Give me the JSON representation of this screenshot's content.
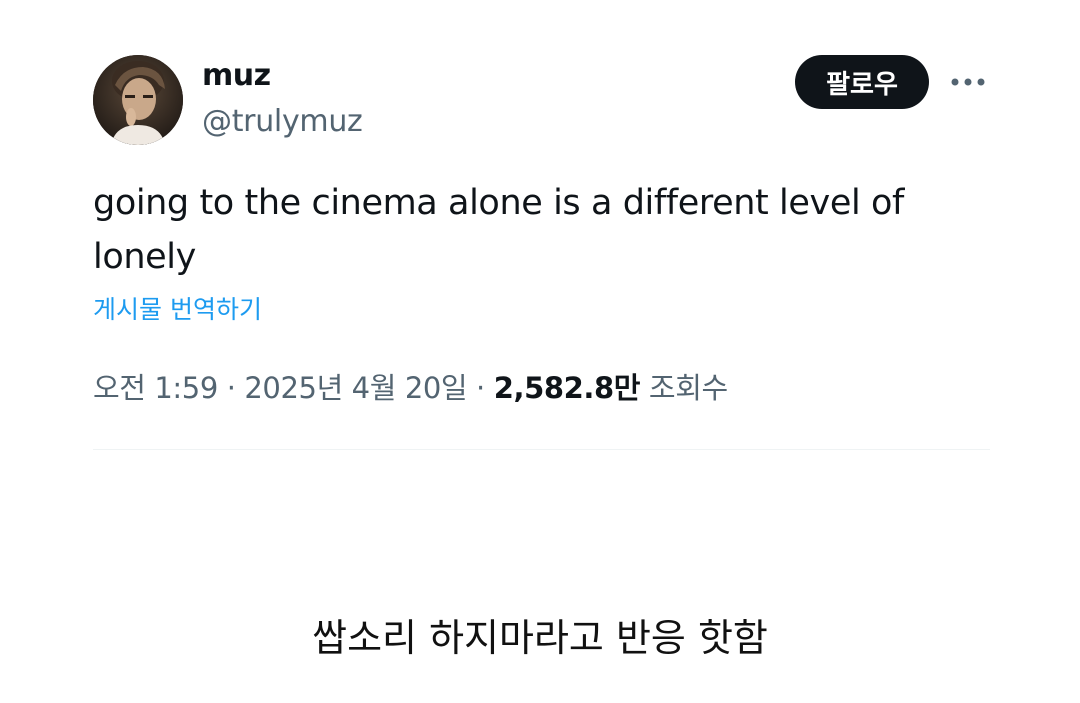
{
  "author": {
    "display_name": "muz",
    "handle": "@trulymuz"
  },
  "follow_button_label": "팔로우",
  "more_icon": "more-horizontal-icon",
  "tweet": {
    "text": "going to the cinema alone is a different level of lonely",
    "translate_label": "게시물 번역하기"
  },
  "meta": {
    "time": "오전 1:59",
    "separator": " · ",
    "date": "2025년 4월 20일",
    "views_count": "2,582.8만",
    "views_label": " 조회수"
  },
  "caption": "쌉소리 하지마라고 반응 핫함",
  "colors": {
    "link": "#1d9bf0",
    "secondary_text": "#536471",
    "primary_text": "#0f1419",
    "follow_button_bg": "#0f1419"
  }
}
